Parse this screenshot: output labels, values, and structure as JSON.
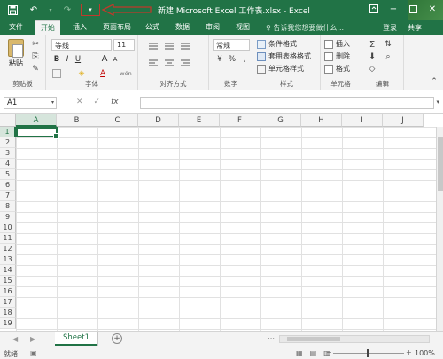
{
  "titlebar": {
    "title": "新建 Microsoft Excel 工作表.xlsx - Excel",
    "qat_dropdown_symbol": "▾",
    "bg_color": "#217346"
  },
  "tabs": [
    {
      "label": "文件",
      "active": false
    },
    {
      "label": "开始",
      "active": true
    },
    {
      "label": "插入",
      "active": false
    },
    {
      "label": "页面布局",
      "active": false
    },
    {
      "label": "公式",
      "active": false
    },
    {
      "label": "数据",
      "active": false
    },
    {
      "label": "审阅",
      "active": false
    },
    {
      "label": "视图",
      "active": false
    }
  ],
  "tellme": "♀ 告诉我您想要做什么...",
  "login": "登录",
  "share": "共享",
  "ribbon": {
    "clipboard": {
      "paste_label": "粘贴",
      "group_label": "剪贴板"
    },
    "font": {
      "font_name": "等线",
      "font_size": "11",
      "bold": "B",
      "italic": "I",
      "underline": "U",
      "grow": "A",
      "shrink": "A",
      "fill_glyph": "◈",
      "fontcolor": "A",
      "wen": "wén",
      "group_label": "字体"
    },
    "alignment": {
      "group_label": "对齐方式"
    },
    "number": {
      "format": "常规",
      "percent": "%",
      "comma": ",",
      "group_label": "数字"
    },
    "styles": {
      "conditional": "条件格式",
      "table": "套用表格格式",
      "cell": "单元格样式",
      "group_label": "样式"
    },
    "cells": {
      "insert": "插入",
      "delete": "删除",
      "format": "格式",
      "group_label": "单元格"
    },
    "editing": {
      "group_label": "编辑"
    }
  },
  "formula_bar": {
    "name_box": "A1",
    "fx": "fx",
    "cancel": "✕",
    "enter": "✓"
  },
  "grid": {
    "columns": [
      "A",
      "B",
      "C",
      "D",
      "E",
      "F",
      "G",
      "H",
      "I",
      "J"
    ],
    "rows": [
      "1",
      "2",
      "3",
      "4",
      "5",
      "6",
      "7",
      "8",
      "9",
      "10",
      "11",
      "12",
      "13",
      "14",
      "15",
      "16",
      "17",
      "18",
      "19"
    ],
    "active_cell": "A1"
  },
  "sheets": {
    "tabs": [
      "Sheet1"
    ],
    "add_symbol": "+",
    "nav_left": "◀",
    "nav_right": "▶",
    "dots": "⋯"
  },
  "status": {
    "ready": "就绪",
    "zoom": "100%",
    "minus": "−",
    "plus": "+"
  }
}
